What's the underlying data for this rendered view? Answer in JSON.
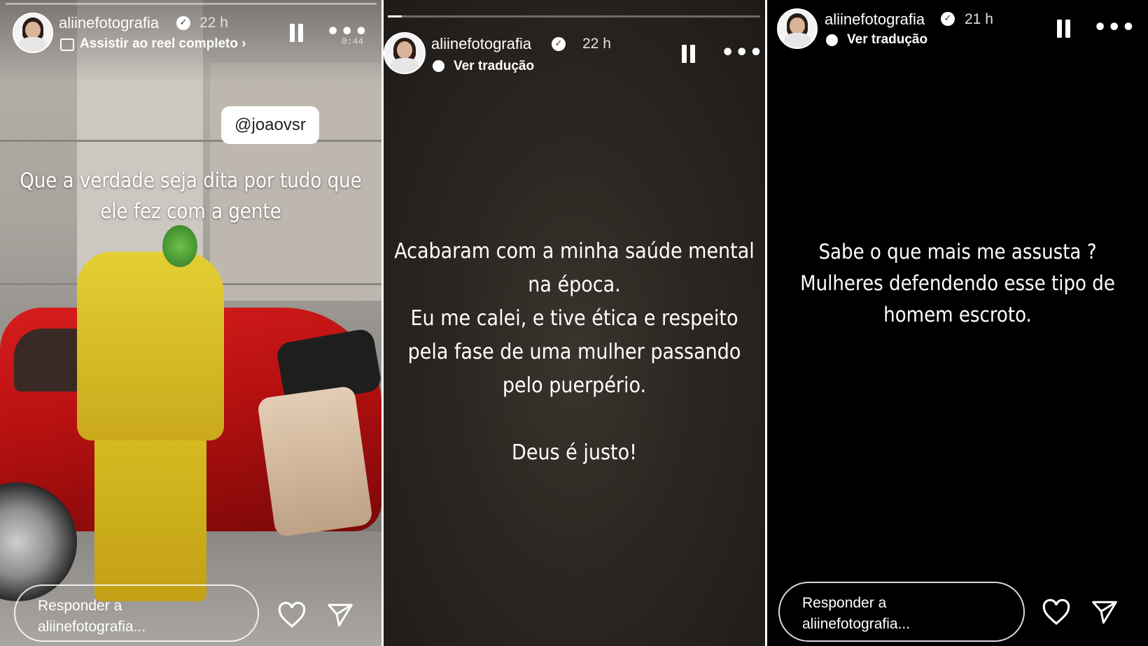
{
  "stories": [
    {
      "username": "aliinefotografia",
      "time": "22 h",
      "subtitle": "Assistir ao reel completo",
      "video_time": "0:44",
      "mention": "@joaovsr",
      "caption_lines": [
        "Que a verdade seja dita por tudo que",
        "ele fez com a gente"
      ],
      "reply_lines": [
        "Responder a",
        "aliinefotografia..."
      ]
    },
    {
      "username": "aliinefotografia",
      "time": "22 h",
      "subtitle": "Ver tradução",
      "caption_lines": [
        "Acabaram com a minha saúde mental",
        "na época.",
        "Eu me calei, e tive ética  e respeito",
        "pela fase de uma mulher passando",
        "pelo puerpério.",
        "",
        "Deus é justo!"
      ]
    },
    {
      "username": "aliinefotografia",
      "time": "21 h",
      "subtitle": "Ver tradução",
      "caption_lines": [
        "Sabe o que mais me assusta ?",
        "Mulheres defendendo esse tipo de",
        "homem escroto."
      ],
      "reply_lines": [
        "Responder a",
        "aliinefotografia..."
      ]
    }
  ],
  "icons": {
    "verified": "verified-badge-icon",
    "pause": "pause-icon",
    "more": "more-options-icon",
    "like": "heart-icon",
    "share": "send-icon",
    "reel": "reel-icon",
    "translate": "speech-bubble-icon"
  },
  "colors": {
    "panel3_bg": "#000000",
    "panel2_bg": "#2b2621",
    "car_red": "#d81d1d",
    "suit_yellow": "#e3cf34"
  }
}
